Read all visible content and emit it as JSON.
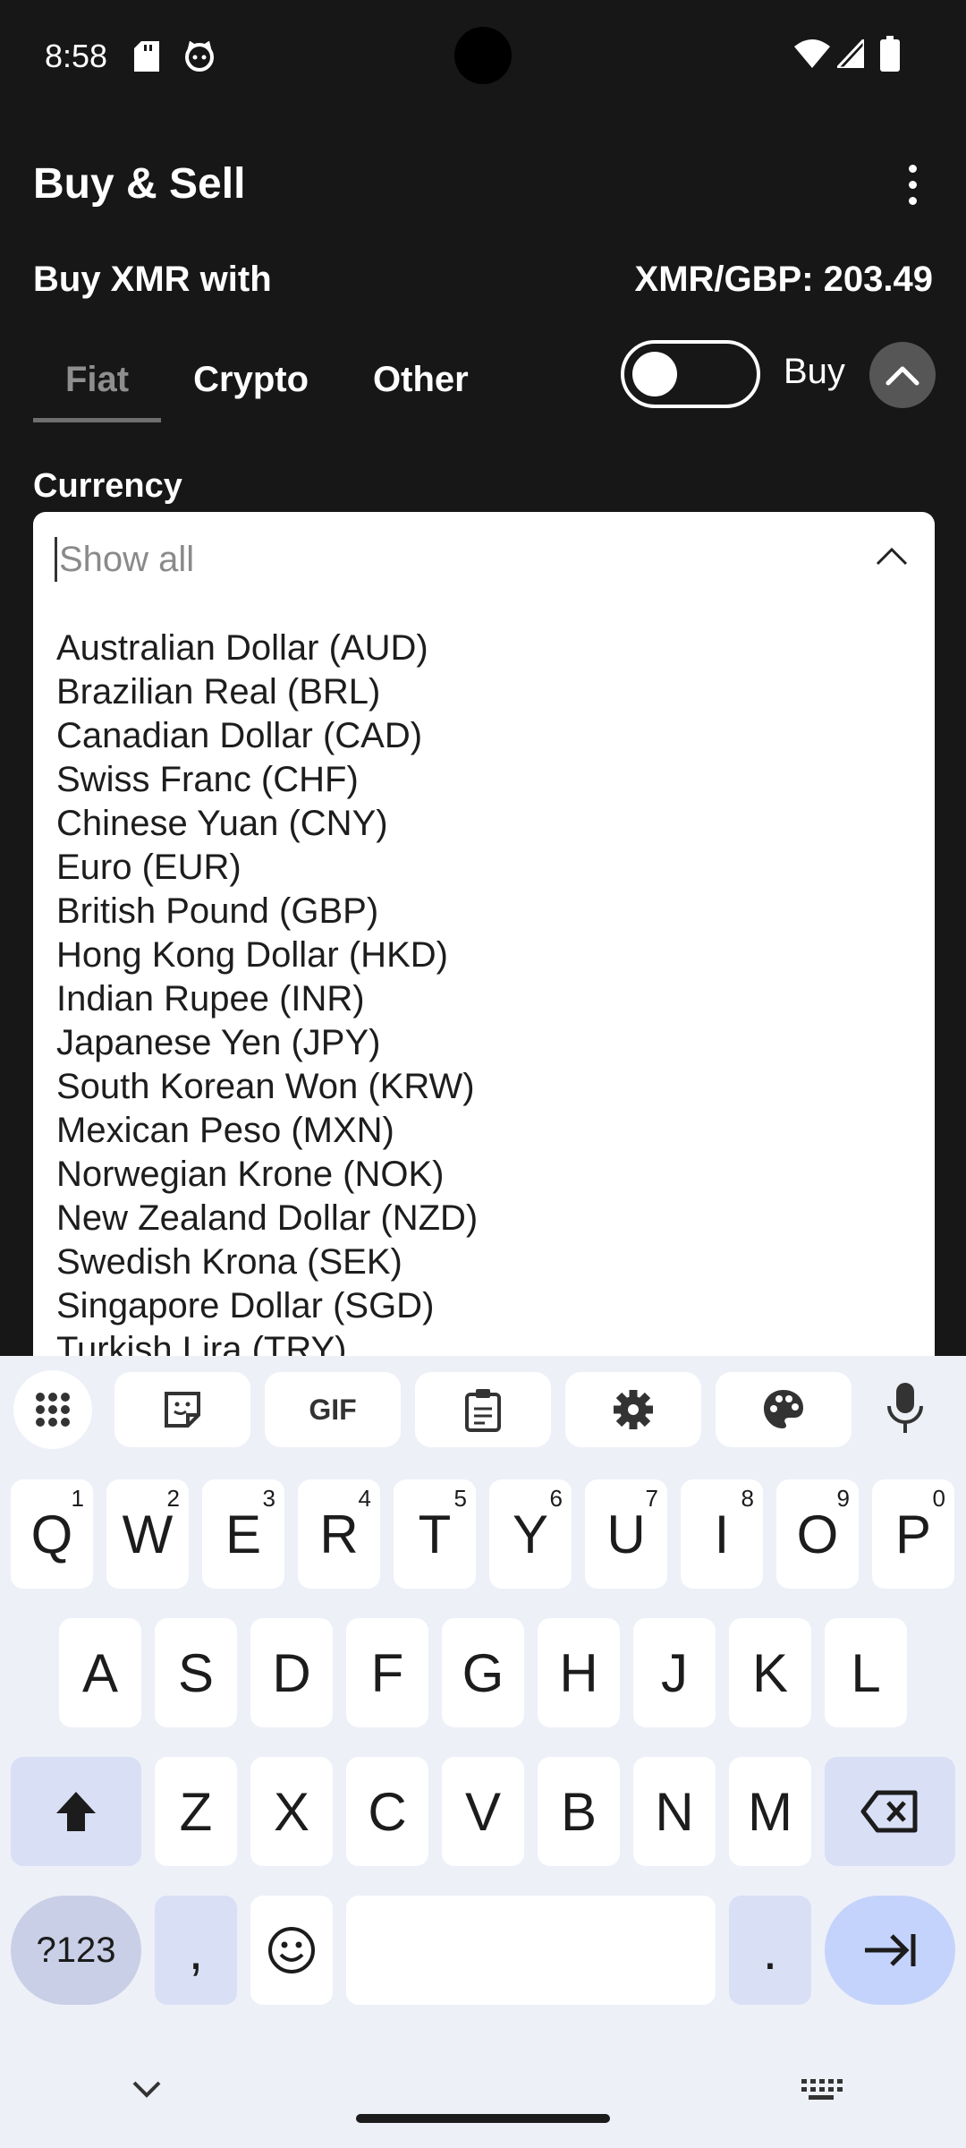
{
  "status_bar": {
    "time": "8:58",
    "icons": [
      "sd-card-icon",
      "cat-icon",
      "wifi-icon",
      "signal-icon",
      "battery-icon"
    ]
  },
  "header": {
    "title": "Buy & Sell",
    "more_icon": "more-vertical-icon"
  },
  "trade": {
    "buy_with": "Buy XMR with",
    "rate": "XMR/GBP: 203.49",
    "tabs": [
      {
        "label": "Fiat",
        "active": true
      },
      {
        "label": "Crypto",
        "active": false
      },
      {
        "label": "Other",
        "active": false
      }
    ],
    "toggle_on": false,
    "mode_label": "Buy"
  },
  "currency": {
    "label": "Currency",
    "search_placeholder": "Show all",
    "options": [
      "Australian Dollar (AUD)",
      "Brazilian Real (BRL)",
      "Canadian Dollar (CAD)",
      "Swiss Franc (CHF)",
      "Chinese Yuan (CNY)",
      "Euro (EUR)",
      "British Pound (GBP)",
      "Hong Kong Dollar (HKD)",
      "Indian Rupee (INR)",
      "Japanese Yen (JPY)",
      "South Korean Won (KRW)",
      "Mexican Peso (MXN)",
      "Norwegian Krone (NOK)",
      "New Zealand Dollar (NZD)",
      "Swedish Krona (SEK)",
      "Singapore Dollar (SGD)",
      "Turkish Lira (TRY)"
    ]
  },
  "keyboard": {
    "toolbar": {
      "gif_label": "GIF",
      "icons": [
        "apps-grid-icon",
        "sticker-icon",
        "clipboard-icon",
        "settings-icon",
        "palette-icon",
        "microphone-icon"
      ]
    },
    "row1": [
      "Q",
      "W",
      "E",
      "R",
      "T",
      "Y",
      "U",
      "I",
      "O",
      "P"
    ],
    "row1_hints": [
      "1",
      "2",
      "3",
      "4",
      "5",
      "6",
      "7",
      "8",
      "9",
      "0"
    ],
    "row2": [
      "A",
      "S",
      "D",
      "F",
      "G",
      "H",
      "J",
      "K",
      "L"
    ],
    "row3": [
      "Z",
      "X",
      "C",
      "V",
      "B",
      "N",
      "M"
    ],
    "symbols_label": "?123",
    "comma_label": ",",
    "period_label": ".",
    "accent_color": "#c4d3fb"
  }
}
